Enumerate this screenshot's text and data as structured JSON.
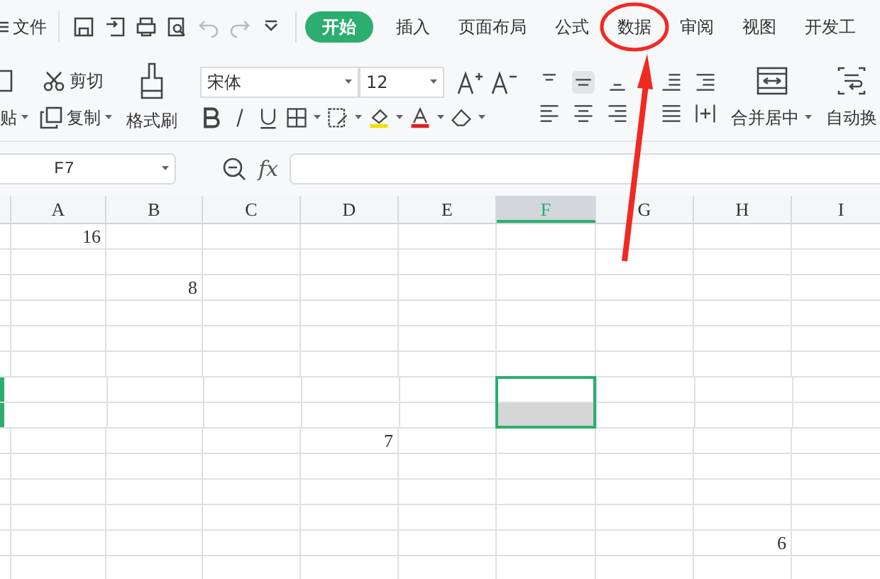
{
  "menu": {
    "label": "文件"
  },
  "tabs": [
    {
      "label": "开始",
      "selected": true
    },
    {
      "label": "插入",
      "selected": false
    },
    {
      "label": "页面布局",
      "selected": false
    },
    {
      "label": "公式",
      "selected": false
    },
    {
      "label": "数据",
      "selected": false
    },
    {
      "label": "审阅",
      "selected": false
    },
    {
      "label": "视图",
      "selected": false
    },
    {
      "label": "开发工",
      "selected": false
    }
  ],
  "clipboard": {
    "paste": "贴",
    "cut": "剪切",
    "copy": "复制",
    "format_painter": "格式刷"
  },
  "font": {
    "name": "宋体",
    "size": "12"
  },
  "alignment": {
    "merge": "合并居中",
    "wrap": "自动换"
  },
  "name_box": "F7",
  "formula_label": "fx",
  "columns": [
    {
      "label": "A",
      "selected": false
    },
    {
      "label": "B",
      "selected": false
    },
    {
      "label": "C",
      "selected": false
    },
    {
      "label": "D",
      "selected": false
    },
    {
      "label": "E",
      "selected": false
    },
    {
      "label": "F",
      "selected": true
    },
    {
      "label": "G",
      "selected": false
    },
    {
      "label": "H",
      "selected": false
    },
    {
      "label": "I",
      "selected": false
    }
  ],
  "rows": [
    {
      "selected": false,
      "active": false,
      "cells": [
        "16",
        null,
        null,
        null,
        null,
        null,
        null,
        null,
        null
      ]
    },
    {
      "selected": false,
      "active": false,
      "cells": [
        null,
        null,
        null,
        null,
        null,
        null,
        null,
        null,
        null
      ]
    },
    {
      "selected": false,
      "active": false,
      "cells": [
        null,
        "8",
        null,
        null,
        null,
        null,
        null,
        null,
        null
      ]
    },
    {
      "selected": false,
      "active": false,
      "cells": [
        null,
        null,
        null,
        null,
        null,
        null,
        null,
        null,
        null
      ]
    },
    {
      "selected": false,
      "active": false,
      "cells": [
        null,
        null,
        null,
        null,
        null,
        null,
        null,
        null,
        null
      ]
    },
    {
      "selected": false,
      "active": false,
      "cells": [
        null,
        null,
        null,
        null,
        null,
        null,
        null,
        null,
        null
      ]
    },
    {
      "selected": true,
      "active": true,
      "cells": [
        null,
        null,
        null,
        null,
        null,
        null,
        null,
        null,
        null
      ]
    },
    {
      "selected": true,
      "active": false,
      "cells": [
        null,
        null,
        null,
        null,
        null,
        null,
        null,
        null,
        null
      ]
    },
    {
      "selected": false,
      "active": false,
      "cells": [
        null,
        null,
        null,
        "7",
        null,
        null,
        null,
        null,
        null
      ]
    },
    {
      "selected": false,
      "active": false,
      "cells": [
        null,
        null,
        null,
        null,
        null,
        null,
        null,
        null,
        null
      ]
    },
    {
      "selected": false,
      "active": false,
      "cells": [
        null,
        null,
        null,
        null,
        null,
        null,
        null,
        null,
        null
      ]
    },
    {
      "selected": false,
      "active": false,
      "cells": [
        null,
        null,
        null,
        null,
        null,
        null,
        null,
        null,
        null
      ]
    },
    {
      "selected": false,
      "active": false,
      "cells": [
        null,
        null,
        null,
        null,
        null,
        null,
        null,
        "6",
        null
      ]
    },
    {
      "selected": false,
      "active": false,
      "cells": [
        null,
        null,
        null,
        null,
        null,
        null,
        null,
        null,
        null
      ]
    }
  ]
}
